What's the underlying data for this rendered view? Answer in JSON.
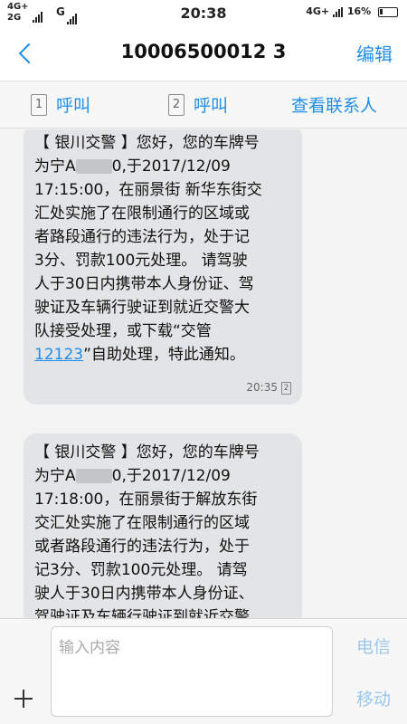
{
  "status_bar": {
    "left_line1": "4G+",
    "left_line2": "2G",
    "carrier_letter": "G",
    "time": "20:38",
    "right_net": "4G+",
    "battery": "16%"
  },
  "header": {
    "title": "10006500012 3",
    "edit_label": "编辑"
  },
  "actions": {
    "call1_sim": "1",
    "call1_label": "呼叫",
    "call2_sim": "2",
    "call2_label": "呼叫",
    "view_contact_label": "查看联系人"
  },
  "messages": [
    {
      "line1": "【 银川交警 】您好，您的车牌号",
      "line2_pre": "为宁A",
      "line2_post": "0,于2017/12/09",
      "line3": "17:15:00，在丽景街 新华东街交",
      "line4": "汇处实施了在限制通行的区域或",
      "line5": "者路段通行的违法行为，处于记",
      "line6": "3分、罚款100元处理。 请驾驶",
      "line7": "人于30日内携带本人身份证、驾",
      "line8": "驶证及车辆行驶证到就近交警大",
      "line9_pre": "队接受处理，或下载“交管",
      "line10_link": "12123",
      "line10_post": "”自助处理，特此通知。",
      "time": "20:35",
      "sim": "2"
    },
    {
      "line1": "【 银川交警 】您好，您的车牌号",
      "line2_pre": "为宁A",
      "line2_post": "0,于2017/12/09",
      "line3": "17:18:00，在丽景街于解放东街",
      "line4": "交汇处实施了在限制通行的区域",
      "line5": "或者路段通行的违法行为，处于",
      "line6": "记3分、罚款100元处理。 请驾",
      "line7": "驶人于30日内携带本人身份证、",
      "line8": "驾驶证及车辆行驶证到就近交警"
    }
  ],
  "composer": {
    "placeholder": "输入内容",
    "send_sim1": "电信",
    "send_sim2": "移动"
  }
}
